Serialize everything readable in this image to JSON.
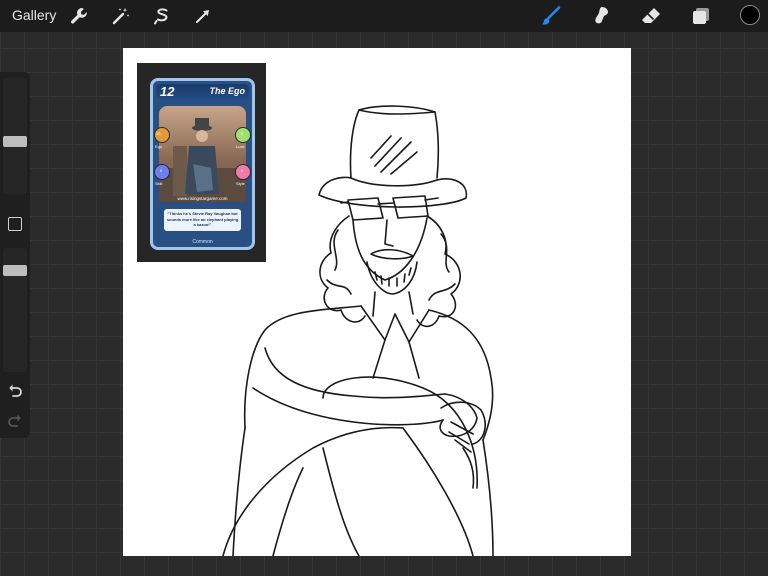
{
  "topbar": {
    "gallery_label": "Gallery",
    "left_tools": [
      "wrench-icon",
      "magic-wand-icon",
      "selection-icon",
      "transform-arrow-icon"
    ],
    "right_tools": [
      "brush-icon",
      "smudge-icon",
      "eraser-icon",
      "layers-icon"
    ],
    "active_tool": "brush",
    "accent_color": "#1e8cf0",
    "current_color": "#000000"
  },
  "sidebar": {
    "brush_size_level": 0.45,
    "opacity_level": 0.85,
    "undo_icon": "undo-icon",
    "redo_icon": "redo-icon"
  },
  "canvas": {
    "reference_card": {
      "number": "12",
      "title": "The Ego",
      "stats": [
        "Ego",
        "Luck",
        "Skill",
        "Style"
      ],
      "stat_values": [
        "35",
        "0",
        "0",
        "0"
      ],
      "url": "www.risingstargame.com",
      "quote": "\"Thinks he's Stevie Ray Vaughan but sounds more like an elephant playing a kazoo!\"",
      "rarity": "Common"
    }
  }
}
